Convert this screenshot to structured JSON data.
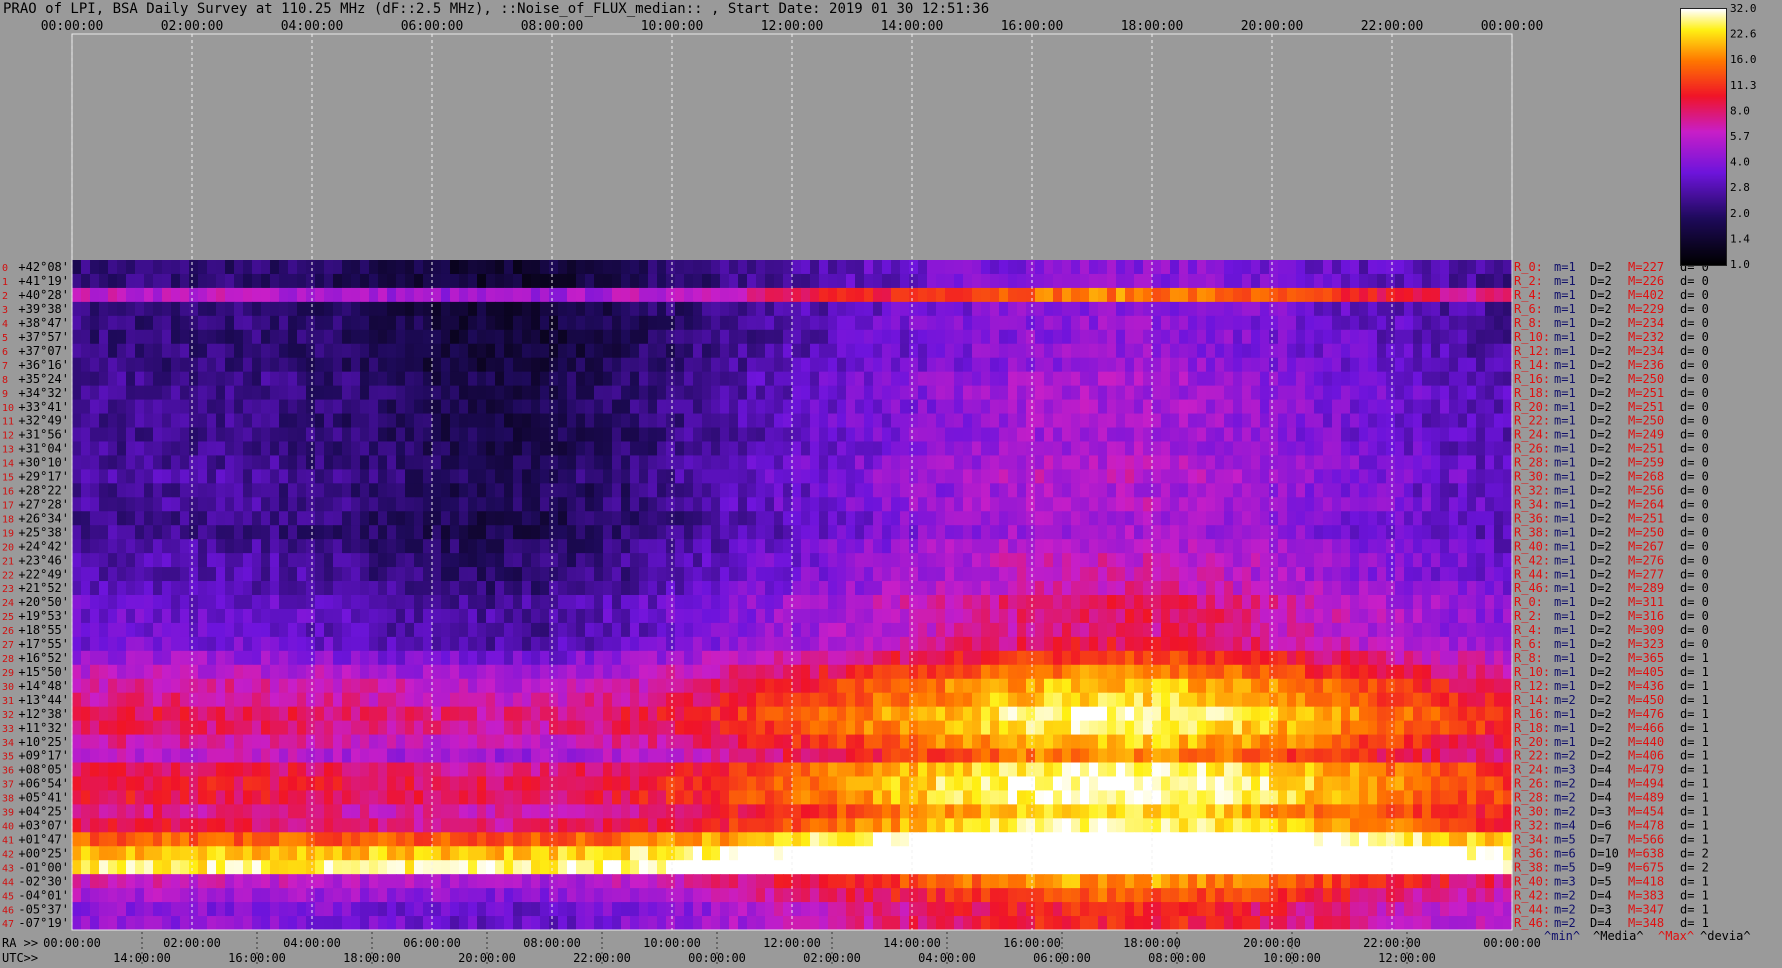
{
  "title": "PRAO of LPI, BSA Daily Survey at 110.25 MHz (dF::2.5 MHz), ::Noise_of_FLUX_median:: , Start Date: 2019 01 30 12:51:36",
  "chart_data": {
    "type": "heatmap",
    "title": "PRAO of LPI, BSA Daily Survey at 110.25 MHz (dF::2.5 MHz), ::Noise_of_FLUX_median:: , Start Date: 2019 01 30 12:51:36",
    "x_top_labels": [
      "00:00:00",
      "02:00:00",
      "04:00:00",
      "06:00:00",
      "08:00:00",
      "10:00:00",
      "12:00:00",
      "14:00:00",
      "16:00:00",
      "18:00:00",
      "20:00:00",
      "22:00:00",
      "00:00:00"
    ],
    "x_bottom_ra_prefix": "RA >>",
    "x_bottom_ra_labels": [
      "00:00:00",
      "02:00:00",
      "04:00:00",
      "06:00:00",
      "08:00:00",
      "10:00:00",
      "12:00:00",
      "14:00:00",
      "16:00:00",
      "18:00:00",
      "20:00:00",
      "22:00:00",
      "00:00:00"
    ],
    "x_bottom_utc_prefix": "UTC>>",
    "x_bottom_utc_labels": [
      "14:00:00",
      "16:00:00",
      "18:00:00",
      "20:00:00",
      "22:00:00",
      "00:00:00",
      "02:00:00",
      "04:00:00",
      "06:00:00",
      "08:00:00",
      "10:00:00",
      "12:00:00"
    ],
    "y_labels": [
      "+42°08'",
      "+41°19'",
      "+40°28'",
      "+39°38'",
      "+38°47'",
      "+37°57'",
      "+37°07'",
      "+36°16'",
      "+35°24'",
      "+34°32'",
      "+33°41'",
      "+32°49'",
      "+31°56'",
      "+31°04'",
      "+30°10'",
      "+29°17'",
      "+28°22'",
      "+27°28'",
      "+26°34'",
      "+25°38'",
      "+24°42'",
      "+23°46'",
      "+22°49'",
      "+21°52'",
      "+20°50'",
      "+19°53'",
      "+18°55'",
      "+17°55'",
      "+16°52'",
      "+15°50'",
      "+14°48'",
      "+13°44'",
      "+12°38'",
      "+11°32'",
      "+10°25'",
      "+09°17'",
      "+08°05'",
      "+06°54'",
      "+05°41'",
      "+04°25'",
      "+03°07'",
      "+01°47'",
      "+00°25'",
      "-01°00'",
      "-02°30'",
      "-04°01'",
      "-05°37'",
      "-07°19'"
    ],
    "colorbar": {
      "ticks": [
        "32.0",
        "22.6",
        "16.0",
        "11.3",
        "8.0",
        "5.7",
        "4.0",
        "2.8",
        "2.0",
        "1.4",
        "1.0"
      ],
      "scale": "log"
    },
    "right_legend": [
      "^min^",
      "^Media^",
      "^Max^",
      "^devia^"
    ],
    "right_stats": [
      {
        "r": "R_0:",
        "m": "m=1",
        "D": "D=2",
        "M": "M=227",
        "d": "d= 0"
      },
      {
        "r": "R_2:",
        "m": "m=1",
        "D": "D=2",
        "M": "M=226",
        "d": "d= 0"
      },
      {
        "r": "R_4:",
        "m": "m=1",
        "D": "D=2",
        "M": "M=402",
        "d": "d= 0"
      },
      {
        "r": "R_6:",
        "m": "m=1",
        "D": "D=2",
        "M": "M=229",
        "d": "d= 0"
      },
      {
        "r": "R_8:",
        "m": "m=1",
        "D": "D=2",
        "M": "M=234",
        "d": "d= 0"
      },
      {
        "r": "R_10:",
        "m": "m=1",
        "D": "D=2",
        "M": "M=232",
        "d": "d= 0"
      },
      {
        "r": "R_12:",
        "m": "m=1",
        "D": "D=2",
        "M": "M=234",
        "d": "d= 0"
      },
      {
        "r": "R_14:",
        "m": "m=1",
        "D": "D=2",
        "M": "M=236",
        "d": "d= 0"
      },
      {
        "r": "R_16:",
        "m": "m=1",
        "D": "D=2",
        "M": "M=250",
        "d": "d= 0"
      },
      {
        "r": "R_18:",
        "m": "m=1",
        "D": "D=2",
        "M": "M=251",
        "d": "d= 0"
      },
      {
        "r": "R_20:",
        "m": "m=1",
        "D": "D=2",
        "M": "M=251",
        "d": "d= 0"
      },
      {
        "r": "R_22:",
        "m": "m=1",
        "D": "D=2",
        "M": "M=250",
        "d": "d= 0"
      },
      {
        "r": "R_24:",
        "m": "m=1",
        "D": "D=2",
        "M": "M=249",
        "d": "d= 0"
      },
      {
        "r": "R_26:",
        "m": "m=1",
        "D": "D=2",
        "M": "M=251",
        "d": "d= 0"
      },
      {
        "r": "R_28:",
        "m": "m=1",
        "D": "D=2",
        "M": "M=259",
        "d": "d= 0"
      },
      {
        "r": "R_30:",
        "m": "m=1",
        "D": "D=2",
        "M": "M=268",
        "d": "d= 0"
      },
      {
        "r": "R_32:",
        "m": "m=1",
        "D": "D=2",
        "M": "M=256",
        "d": "d= 0"
      },
      {
        "r": "R_34:",
        "m": "m=1",
        "D": "D=2",
        "M": "M=264",
        "d": "d= 0"
      },
      {
        "r": "R_36:",
        "m": "m=1",
        "D": "D=2",
        "M": "M=251",
        "d": "d= 0"
      },
      {
        "r": "R_38:",
        "m": "m=1",
        "D": "D=2",
        "M": "M=250",
        "d": "d= 0"
      },
      {
        "r": "R_40:",
        "m": "m=1",
        "D": "D=2",
        "M": "M=267",
        "d": "d= 0"
      },
      {
        "r": "R_42:",
        "m": "m=1",
        "D": "D=2",
        "M": "M=276",
        "d": "d= 0"
      },
      {
        "r": "R_44:",
        "m": "m=1",
        "D": "D=2",
        "M": "M=277",
        "d": "d= 0"
      },
      {
        "r": "R_46:",
        "m": "m=1",
        "D": "D=2",
        "M": "M=289",
        "d": "d= 0"
      },
      {
        "r": "R_0:",
        "m": "m=1",
        "D": "D=2",
        "M": "M=311",
        "d": "d= 0"
      },
      {
        "r": "R_2:",
        "m": "m=1",
        "D": "D=2",
        "M": "M=316",
        "d": "d= 0"
      },
      {
        "r": "R_4:",
        "m": "m=1",
        "D": "D=2",
        "M": "M=309",
        "d": "d= 0"
      },
      {
        "r": "R_6:",
        "m": "m=1",
        "D": "D=2",
        "M": "M=323",
        "d": "d= 0"
      },
      {
        "r": "R_8:",
        "m": "m=1",
        "D": "D=2",
        "M": "M=365",
        "d": "d= 1"
      },
      {
        "r": "R_10:",
        "m": "m=1",
        "D": "D=2",
        "M": "M=405",
        "d": "d= 1"
      },
      {
        "r": "R_12:",
        "m": "m=1",
        "D": "D=2",
        "M": "M=436",
        "d": "d= 1"
      },
      {
        "r": "R_14:",
        "m": "m=2",
        "D": "D=2",
        "M": "M=450",
        "d": "d= 1"
      },
      {
        "r": "R_16:",
        "m": "m=1",
        "D": "D=2",
        "M": "M=476",
        "d": "d= 1"
      },
      {
        "r": "R_18:",
        "m": "m=1",
        "D": "D=2",
        "M": "M=466",
        "d": "d= 1"
      },
      {
        "r": "R_20:",
        "m": "m=1",
        "D": "D=2",
        "M": "M=440",
        "d": "d= 1"
      },
      {
        "r": "R_22:",
        "m": "m=2",
        "D": "D=2",
        "M": "M=406",
        "d": "d= 1"
      },
      {
        "r": "R_24:",
        "m": "m=3",
        "D": "D=4",
        "M": "M=479",
        "d": "d= 1"
      },
      {
        "r": "R_26:",
        "m": "m=2",
        "D": "D=4",
        "M": "M=494",
        "d": "d= 1"
      },
      {
        "r": "R_28:",
        "m": "m=2",
        "D": "D=4",
        "M": "M=489",
        "d": "d= 1"
      },
      {
        "r": "R_30:",
        "m": "m=2",
        "D": "D=3",
        "M": "M=454",
        "d": "d= 1"
      },
      {
        "r": "R_32:",
        "m": "m=4",
        "D": "D=6",
        "M": "M=478",
        "d": "d= 1"
      },
      {
        "r": "R_34:",
        "m": "m=5",
        "D": "D=7",
        "M": "M=566",
        "d": "d= 1"
      },
      {
        "r": "R_36:",
        "m": "m=6",
        "D": "D=10",
        "M": "M=638",
        "d": "d= 2"
      },
      {
        "r": "R_38:",
        "m": "m=5",
        "D": "D=9",
        "M": "M=675",
        "d": "d= 2"
      },
      {
        "r": "R_40:",
        "m": "m=3",
        "D": "D=5",
        "M": "M=418",
        "d": "d= 1"
      },
      {
        "r": "R_42:",
        "m": "m=2",
        "D": "D=4",
        "M": "M=383",
        "d": "d= 1"
      },
      {
        "r": "R_44:",
        "m": "m=2",
        "D": "D=3",
        "M": "M=347",
        "d": "d= 1"
      },
      {
        "r": "R_46:",
        "m": "m=2",
        "D": "D=4",
        "M": "M=348",
        "d": "d= 1"
      }
    ],
    "hot_band_rows": [
      36,
      47
    ],
    "colors": {
      "background": "#9a9a9a",
      "grid": "#f0f0f0",
      "row_label": "#d01010",
      "stat_blue": "#10106a",
      "stat_red": "#e01010"
    }
  }
}
